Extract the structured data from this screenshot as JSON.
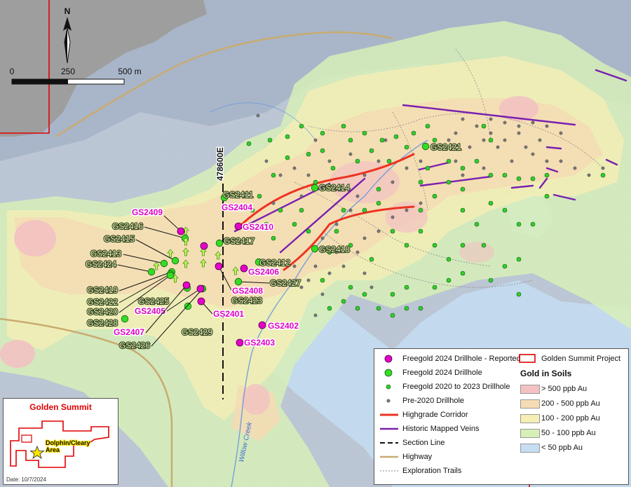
{
  "north_label": "N",
  "scale_bar": {
    "labels": [
      "0",
      "250",
      "500 m"
    ]
  },
  "section_label": "478600E",
  "creek_label": "Willow Creek",
  "drillholes_reported": [
    "GS2409",
    "GS2404",
    "GS2410",
    "GS2406",
    "GS2408",
    "GS2405",
    "GS2401",
    "GS2407",
    "GS2402",
    "GS2403"
  ],
  "drillholes_2024": [
    "GS2421",
    "GS2414",
    "GS2411",
    "GS2416",
    "GS2415",
    "GS2413",
    "GS2424",
    "GS2417",
    "GS2412",
    "GS2418",
    "GS2427",
    "GS2423",
    "GS2419",
    "GS2422",
    "GS2420",
    "GS2425",
    "GS2428",
    "GS2429",
    "GS2426"
  ],
  "legend": {
    "items": [
      {
        "label": "Freegold 2024 Drillhole - Reported",
        "symbol": "magenta-dot-icon"
      },
      {
        "label": "Freegold 2024 Drillhole",
        "symbol": "green-dot-icon"
      },
      {
        "label": "Freegold 2020 to 2023 Drillhole",
        "symbol": "small-green-dot-icon"
      },
      {
        "label": "Pre-2020 Drillhole",
        "symbol": "grey-dot-icon"
      },
      {
        "label": "Highgrade Corridor",
        "symbol": "red-line-icon"
      },
      {
        "label": "Historic Mapped Veins",
        "symbol": "purple-line-icon"
      },
      {
        "label": "Section Line",
        "symbol": "dashed-line-icon"
      },
      {
        "label": "Highway",
        "symbol": "tan-line-icon"
      },
      {
        "label": "Exploration Trails",
        "symbol": "dotted-line-icon"
      }
    ],
    "project_label": "Golden Summit Project",
    "soils_title": "Gold in Soils",
    "soils": [
      {
        "label": "> 500 ppb Au",
        "color": "#f4c2c2"
      },
      {
        "label": "200 - 500 ppb Au",
        "color": "#f6dcb4"
      },
      {
        "label": "100 - 200 ppb Au",
        "color": "#f5efb6"
      },
      {
        "label": "50 - 100 ppb Au",
        "color": "#d8f0b8"
      },
      {
        "label": "< 50 ppb Au",
        "color": "#c6ddf2"
      }
    ]
  },
  "inset": {
    "title": "Golden Summit",
    "area_label": "Dolphin/Cleary Area",
    "area_label_lines": [
      "Dolphin/Cleary",
      "Area"
    ],
    "date": "Date: 10/7/2024"
  },
  "colors": {
    "reported": "#e600c8",
    "drill_2024": "#33dd22",
    "drill_2020": "#2fcf2a",
    "pre2020": "#777777",
    "highgrade": "#ee3322",
    "veins": "#7a1fb0",
    "project_boundary": "#e00000"
  }
}
